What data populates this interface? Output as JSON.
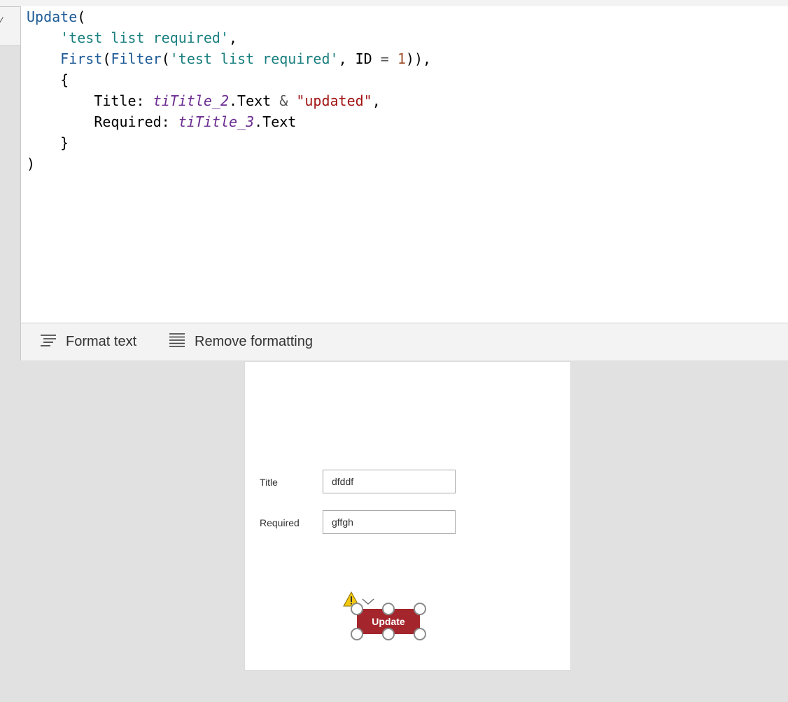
{
  "formula": {
    "line1_fn": "Update",
    "line1_punc": "(",
    "line2_str": "'test list required'",
    "line2_punc": ",",
    "line3_fn_first": "First",
    "line3_fn_filter": "Filter",
    "line3_str": "'test list required'",
    "line3_mid": ", ID ",
    "line3_op": "=",
    "line3_num": "1",
    "line3_end": ")),",
    "line4": "{",
    "line5_key": "Title: ",
    "line5_ctl": "tiTitle_2",
    "line5_prop": ".Text ",
    "line5_op": "&",
    "line5_lit": "\"updated\"",
    "line5_end": ",",
    "line6_key": "Required: ",
    "line6_ctl": "tiTitle_3",
    "line6_prop": ".Text",
    "line7": "}",
    "line8": ")"
  },
  "toolbar": {
    "format_label": "Format text",
    "format_icon": "format-text-icon",
    "remove_label": "Remove formatting",
    "remove_icon": "remove-formatting-icon"
  },
  "form": {
    "title_label": "Title",
    "title_value": "dfddf",
    "required_label": "Required",
    "required_value": "gffgh",
    "update_button": "Update",
    "warning_icon": "warning-icon",
    "chevron_icon": "chevron-down-icon"
  },
  "colors": {
    "button": "#a4262c",
    "warning": "#f2c811",
    "canvas": "#e1e1e1"
  }
}
